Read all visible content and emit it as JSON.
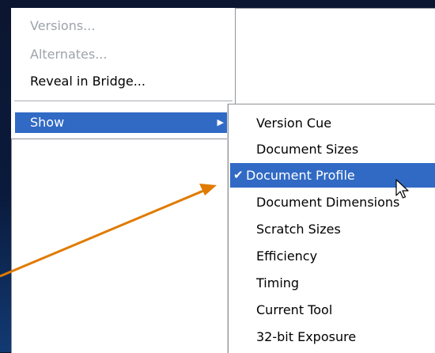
{
  "menu": {
    "items": [
      {
        "label": "Versions...",
        "enabled": false
      },
      {
        "label": "Alternates...",
        "enabled": false
      },
      {
        "label": "Reveal in Bridge...",
        "enabled": true
      }
    ],
    "show_label": "Show"
  },
  "submenu": {
    "items": [
      {
        "label": "Version Cue",
        "checked": false
      },
      {
        "label": "Document Sizes",
        "checked": false
      },
      {
        "label": "Document Profile",
        "checked": true
      },
      {
        "label": "Document Dimensions",
        "checked": false
      },
      {
        "label": "Scratch Sizes",
        "checked": false
      },
      {
        "label": "Efficiency",
        "checked": false
      },
      {
        "label": "Timing",
        "checked": false
      },
      {
        "label": "Current Tool",
        "checked": false
      },
      {
        "label": "32-bit Exposure",
        "checked": false
      }
    ],
    "check_glyph": "✔"
  },
  "colors": {
    "highlight": "#316ac5",
    "annotation_arrow": "#e07b00",
    "disabled_text": "#9ea3ab"
  }
}
